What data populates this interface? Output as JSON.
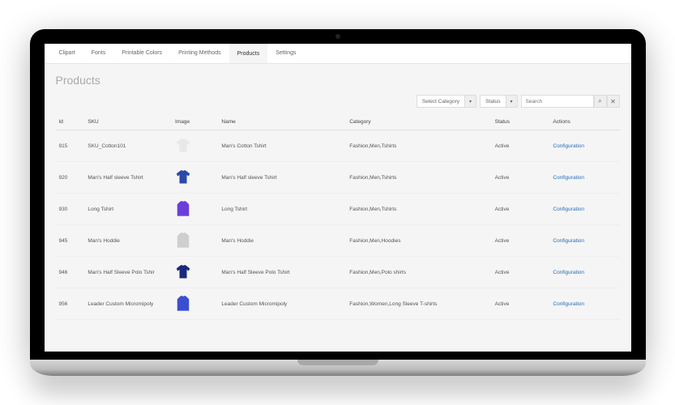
{
  "tabs": [
    {
      "label": "Clipart"
    },
    {
      "label": "Fonts"
    },
    {
      "label": "Printable Colors"
    },
    {
      "label": "Printing Methods"
    },
    {
      "label": "Products",
      "active": true
    },
    {
      "label": "Settings"
    }
  ],
  "page": {
    "title": "Products"
  },
  "filters": {
    "category_label": "Select Category",
    "status_label": "Status",
    "search_placeholder": "Search"
  },
  "table": {
    "headers": {
      "id": "Id",
      "sku": "SKU",
      "image": "Image",
      "name": "Name",
      "category": "Category",
      "status": "Status",
      "actions": "Actions"
    },
    "rows": [
      {
        "id": "915",
        "sku": "SKU_Cotton101",
        "name": "Man's Cotton Tshirt",
        "category": "Fashion,Men,Tshirts",
        "status": "Active",
        "action": "Configuration",
        "thumb_color": "#e8e8e8",
        "thumb_type": "tshirt"
      },
      {
        "id": "920",
        "sku": "Man's Half sleeve Tshirt",
        "name": "Man's Half sleeve Tshirt",
        "category": "Fashion,Men,Tshirts",
        "status": "Active",
        "action": "Configuration",
        "thumb_color": "#2b4aa8",
        "thumb_type": "tshirt"
      },
      {
        "id": "930",
        "sku": "Long Tshirt",
        "name": "Long Tshirt",
        "category": "Fashion,Men,Tshirts",
        "status": "Active",
        "action": "Configuration",
        "thumb_color": "#6a3fd8",
        "thumb_type": "long"
      },
      {
        "id": "945",
        "sku": "Man's Hoddie",
        "name": "Man's Hoddie",
        "category": "Fashion,Men,Hoodies",
        "status": "Active",
        "action": "Configuration",
        "thumb_color": "#cfcfcf",
        "thumb_type": "long"
      },
      {
        "id": "946",
        "sku": "Man's Half Sleeve Polo Tshir",
        "name": "Man's Half Sleeve Polo Tshirt",
        "category": "Fashion,Men,Polo shirts",
        "status": "Active",
        "action": "Configuration",
        "thumb_color": "#1a2a7a",
        "thumb_type": "tshirt"
      },
      {
        "id": "956",
        "sku": "Leader Custom Micromipoly",
        "name": "Leader Custom Micromipoly",
        "category": "Fashion,Women,Long Sleeve T-shirts",
        "status": "Active",
        "action": "Configuration",
        "thumb_color": "#3a4fd0",
        "thumb_type": "long"
      }
    ]
  }
}
